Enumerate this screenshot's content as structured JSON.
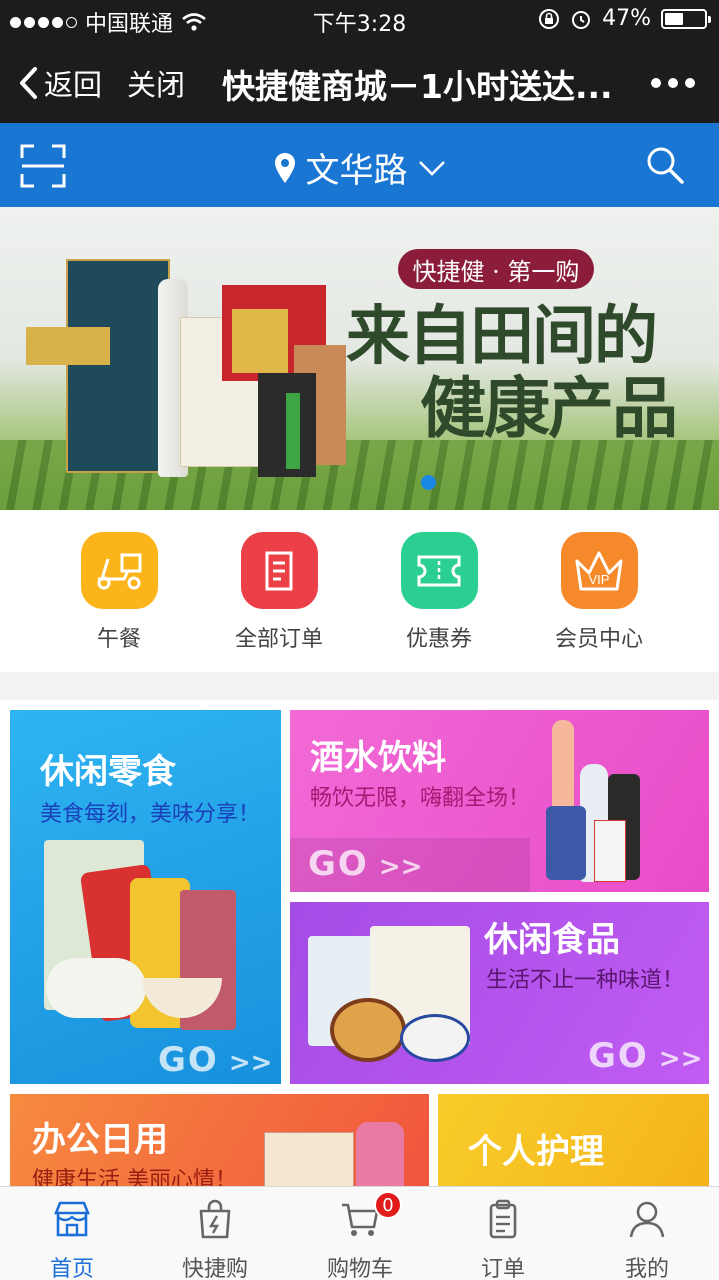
{
  "status_bar": {
    "carrier": "中国联通",
    "time": "下午3:28",
    "battery_percent": "47%",
    "battery_level": 0.47
  },
  "nav": {
    "back_label": "返回",
    "close_label": "关闭",
    "title": "快捷健商城－1小时送达..."
  },
  "location_bar": {
    "location": "文华路"
  },
  "banner": {
    "tag": "快捷健 · 第一购",
    "headline_line1": "来自田间的",
    "headline_line2": "健康产品",
    "active_slide": 1
  },
  "quick_links": [
    {
      "label": "午餐",
      "icon": "scooter-icon",
      "color": "#fbb51b"
    },
    {
      "label": "全部订单",
      "icon": "order-list-icon",
      "color": "#ec4048"
    },
    {
      "label": "优惠券",
      "icon": "ticket-icon",
      "color": "#2bcf92"
    },
    {
      "label": "会员中心",
      "icon": "vip-crown-icon",
      "color": "#f68a2a"
    }
  ],
  "categories": [
    {
      "title": "休闲零食",
      "subtitle": "美食每刻，美味分享！",
      "go": "GO",
      "color": "#23a7ea"
    },
    {
      "title": "酒水饮料",
      "subtitle": "畅饮无限，嗨翻全场！",
      "go": "GO",
      "color": "#f25ad0"
    },
    {
      "title": "休闲食品",
      "subtitle": "生活不止一种味道！",
      "go": "GO",
      "color": "#b653f0"
    },
    {
      "title": "办公日用",
      "subtitle": "健康生活 美丽心情！",
      "color": "#f46b3e"
    },
    {
      "title": "个人护理",
      "color": "#f7c21b"
    }
  ],
  "tab_bar": {
    "tabs": [
      {
        "label": "首页",
        "icon": "store-icon",
        "active": true
      },
      {
        "label": "快捷购",
        "icon": "lightning-bag-icon",
        "active": false
      },
      {
        "label": "购物车",
        "icon": "cart-icon",
        "active": false
      },
      {
        "label": "订单",
        "icon": "clipboard-icon",
        "active": false
      },
      {
        "label": "我的",
        "icon": "person-icon",
        "active": false
      }
    ],
    "cart_count": "0"
  },
  "colors": {
    "brand_blue": "#1976d2",
    "active_tab": "#1b6fd8",
    "nav_bg": "#1c1c1e"
  }
}
